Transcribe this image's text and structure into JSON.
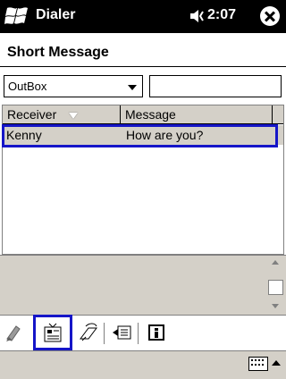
{
  "titlebar": {
    "app_title": "Dialer",
    "time": "2:07",
    "icons": [
      "windows-start-icon",
      "volume-icon",
      "close-icon"
    ]
  },
  "page": {
    "title": "Short Message"
  },
  "filter": {
    "folder": "OutBox",
    "search_value": ""
  },
  "list": {
    "columns": [
      {
        "label": "Receiver",
        "sort_icon": "sort-down-icon"
      },
      {
        "label": "Message"
      }
    ],
    "rows": [
      {
        "receiver": "Kenny",
        "message": "How are you?",
        "selected": true
      }
    ]
  },
  "toolbar": {
    "buttons": [
      "new-message-icon",
      "contacts-icon",
      "send-receive-icon",
      "reply-icon",
      "info-icon"
    ]
  },
  "colors": {
    "highlight": "#1515c8",
    "selection": "#d4d0c8"
  }
}
